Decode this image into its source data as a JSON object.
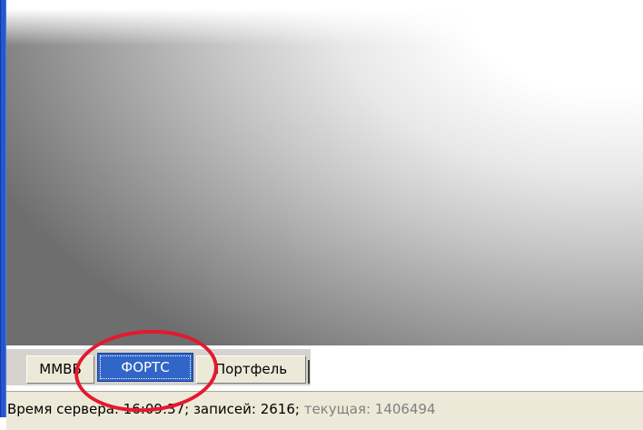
{
  "tabs": [
    {
      "label": "ММВБ",
      "active": false
    },
    {
      "label": "ФОРТС",
      "active": true
    },
    {
      "label": "Портфель",
      "active": false
    }
  ],
  "status": {
    "prefix": "Время сервера: 16:09:37; записей: 2616; ",
    "current": "текущая: 1406494"
  },
  "colors": {
    "active_tab": "#3165c7",
    "annotation": "#e3192f",
    "frame": "#1e4fc6"
  }
}
